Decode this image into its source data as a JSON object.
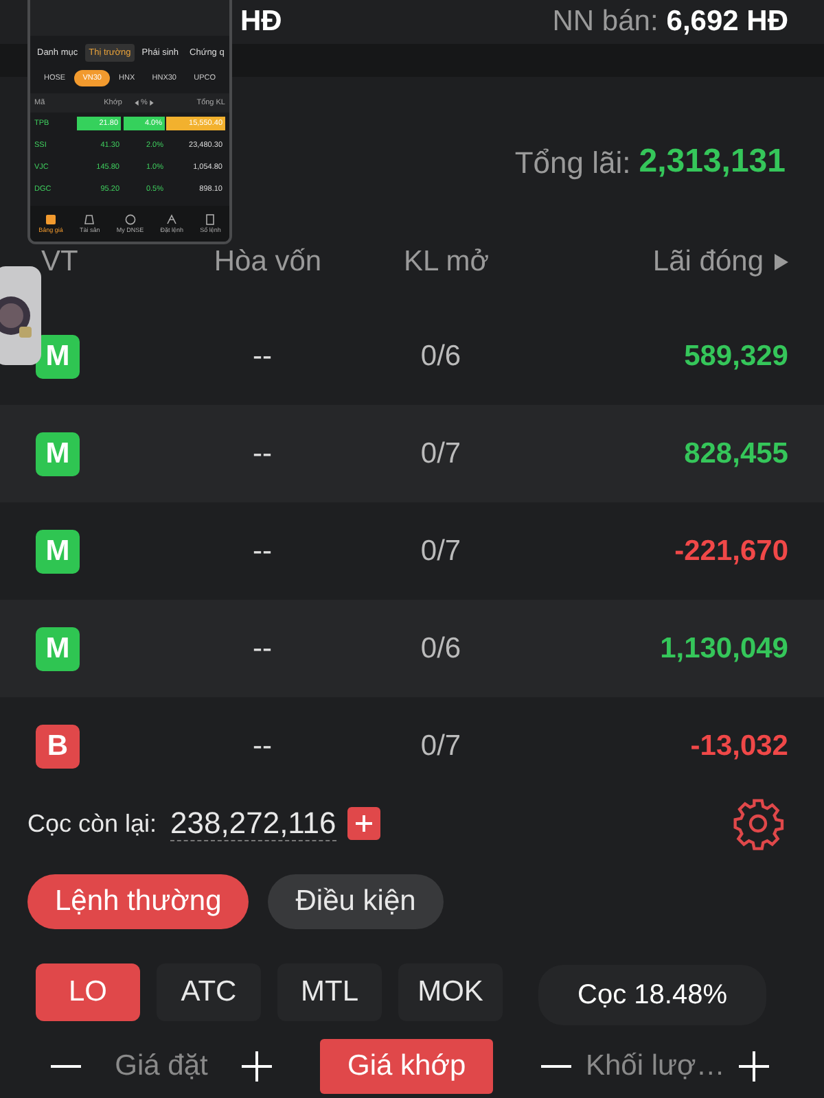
{
  "top_bar": {
    "unit": "HĐ",
    "foreign_sell_label": "NN bán:",
    "foreign_sell_value": "6,692 HĐ"
  },
  "summary": {
    "label": "Tổng lãi:",
    "value": "2,313,131",
    "color": "#35c65a"
  },
  "columns": [
    "VT",
    "Hòa vốn",
    "KL mở",
    "Lãi đóng"
  ],
  "positions": [
    {
      "badge": "M",
      "color": "#2fc552",
      "break_even": "--",
      "open_volume": "0/6",
      "closed_profit": {
        "text": "589,329",
        "color": "#35c65a"
      }
    },
    {
      "badge": "M",
      "color": "#2fc552",
      "break_even": "--",
      "open_volume": "0/7",
      "closed_profit": {
        "text": "828,455",
        "color": "#35c65a"
      }
    },
    {
      "badge": "M",
      "color": "#2fc552",
      "break_even": "--",
      "open_volume": "0/7",
      "closed_profit": {
        "text": "-221,670",
        "color": "#f04848"
      }
    },
    {
      "badge": "M",
      "color": "#2fc552",
      "break_even": "--",
      "open_volume": "0/6",
      "closed_profit": {
        "text": "1,130,049",
        "color": "#35c65a"
      }
    },
    {
      "badge": "B",
      "color": "#e0484a",
      "break_even": "--",
      "open_volume": "0/7",
      "closed_profit": {
        "text": "-13,032",
        "color": "#f04848"
      }
    }
  ],
  "deposit": {
    "label": "Cọc còn lại:",
    "value": "238,272,116"
  },
  "order_tabs": [
    {
      "label": "Lệnh thường",
      "selected": true
    },
    {
      "label": "Điều kiện",
      "selected": false
    }
  ],
  "order_types": [
    {
      "label": "LO",
      "selected": true
    },
    {
      "label": "ATC",
      "selected": false
    },
    {
      "label": "MTL",
      "selected": false
    },
    {
      "label": "MOK",
      "selected": false
    }
  ],
  "margin_rate": "Cọc 18.48%",
  "price_field": {
    "placeholder": "Giá đặt"
  },
  "match_price_button": "Giá khớp",
  "volume_field": {
    "placeholder": "Khối lượ…"
  },
  "inset": {
    "tabs": [
      {
        "label": "Danh mục",
        "selected": false
      },
      {
        "label": "Thị trường",
        "selected": true
      },
      {
        "label": "Phái sinh",
        "selected": false
      },
      {
        "label": "Chứng q",
        "selected": false
      }
    ],
    "exchanges": [
      {
        "label": "HOSE",
        "selected": false
      },
      {
        "label": "VN30",
        "selected": true
      },
      {
        "label": "HNX",
        "selected": false
      },
      {
        "label": "HNX30",
        "selected": false
      },
      {
        "label": "UPCO",
        "selected": false
      }
    ],
    "columns": [
      "Mã",
      "Khớp",
      "%",
      "Tổng KL"
    ],
    "rows": [
      {
        "symbol": "TPB",
        "price": "21.80",
        "change": "4.0%",
        "volume": "15,550.40",
        "flash": true
      },
      {
        "symbol": "SSI",
        "price": "41.30",
        "change": "2.0%",
        "volume": "23,480.30",
        "flash": false
      },
      {
        "symbol": "VJC",
        "price": "145.80",
        "change": "1.0%",
        "volume": "1,054.80",
        "flash": false
      },
      {
        "symbol": "DGC",
        "price": "95.20",
        "change": "0.5%",
        "volume": "898.10",
        "flash": false
      }
    ],
    "nav": [
      {
        "label": "Bảng giá",
        "selected": true
      },
      {
        "label": "Tài sản",
        "selected": false
      },
      {
        "label": "My DNSE",
        "selected": false
      },
      {
        "label": "Đặt lệnh",
        "selected": false
      },
      {
        "label": "Sổ lệnh",
        "selected": false
      }
    ]
  }
}
